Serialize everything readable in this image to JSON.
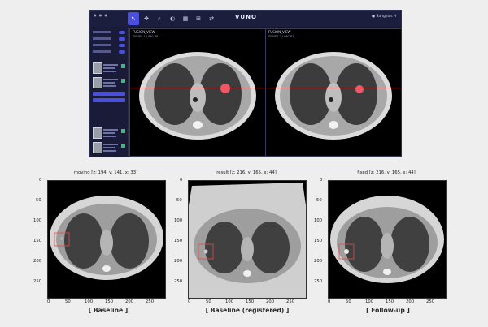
{
  "app": {
    "brand": "VUNO",
    "user": "Sangyun.H",
    "viewports": [
      {
        "label": "FUSION_VIEW",
        "sublabel": "SERIES 1 / IMG 78"
      },
      {
        "label": "FUSION_VIEW",
        "sublabel": "SERIES 2 / IMG 81"
      }
    ]
  },
  "panels": [
    {
      "title": "moving [z: 194, y: 141, x: 33]",
      "caption": "[ Baseline ]"
    },
    {
      "title": "result [z: 216, y: 165, x: 44]",
      "caption": "[ Baseline (registered) ]"
    },
    {
      "title": "fixed [z: 216, y: 165, x: 44]",
      "caption": "[ Follow-up ]"
    }
  ],
  "axis": {
    "yticks": [
      "0",
      "50",
      "100",
      "150",
      "200",
      "250"
    ],
    "xticks": [
      "0",
      "50",
      "100",
      "150",
      "200",
      "250"
    ]
  }
}
